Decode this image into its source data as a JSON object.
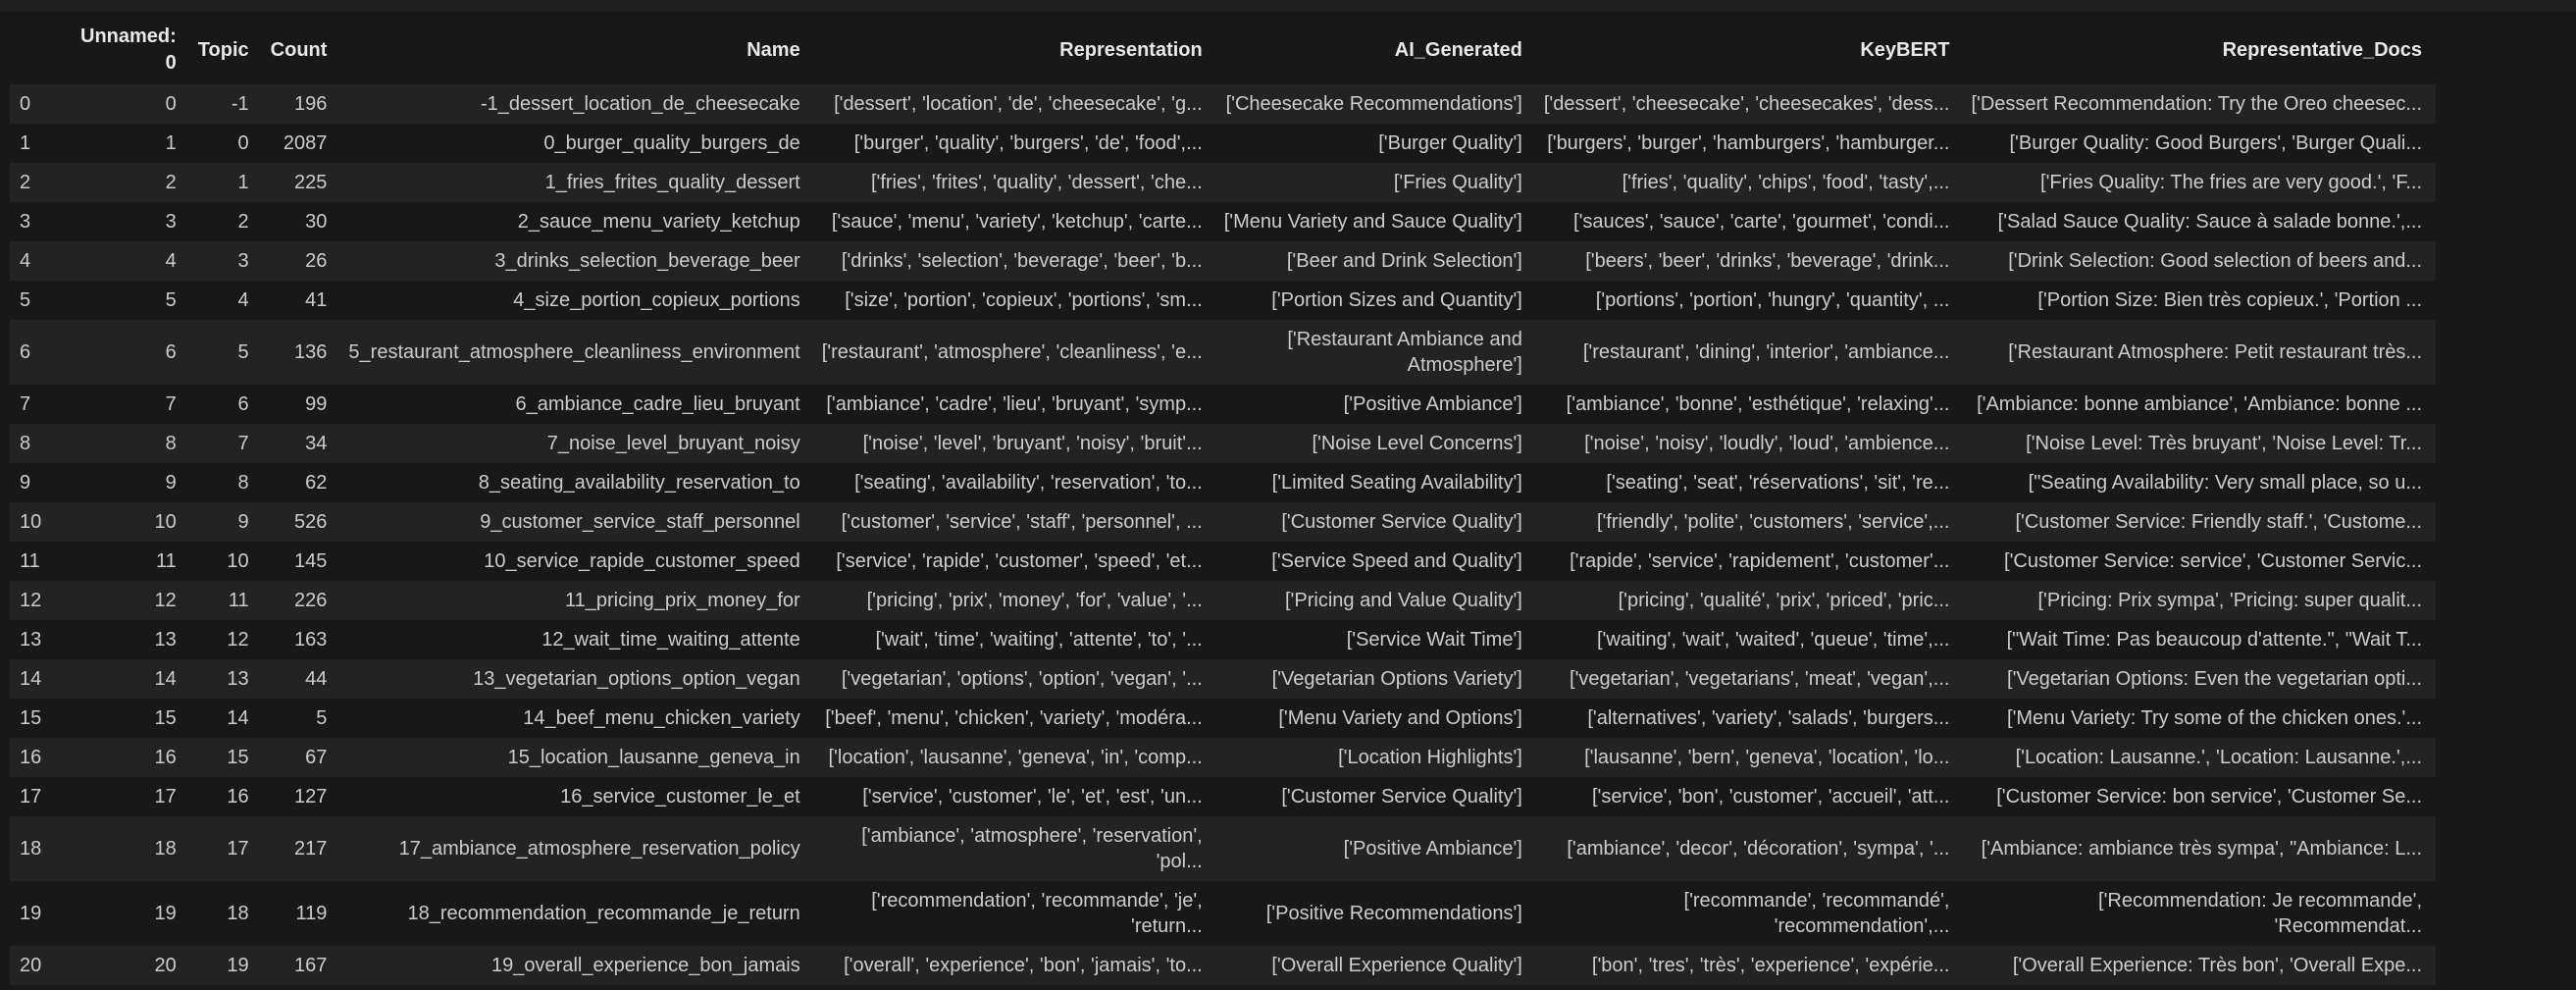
{
  "table": {
    "columns": [
      "",
      "Unnamed: 0",
      "Topic",
      "Count",
      "Name",
      "Representation",
      "AI_Generated",
      "KeyBERT",
      "Representative_Docs"
    ],
    "rows": [
      [
        "0",
        "0",
        "-1",
        "196",
        "-1_dessert_location_de_cheesecake",
        "['dessert', 'location', 'de', 'cheesecake', 'g...",
        "['Cheesecake Recommendations']",
        "['dessert', 'cheesecake', 'cheesecakes', 'dess...",
        "['Dessert Recommendation: Try the Oreo cheesec..."
      ],
      [
        "1",
        "1",
        "0",
        "2087",
        "0_burger_quality_burgers_de",
        "['burger', 'quality', 'burgers', 'de', 'food',...",
        "['Burger Quality']",
        "['burgers', 'burger', 'hamburgers', 'hamburger...",
        "['Burger Quality: Good Burgers', 'Burger Quali..."
      ],
      [
        "2",
        "2",
        "1",
        "225",
        "1_fries_frites_quality_dessert",
        "['fries', 'frites', 'quality', 'dessert', 'che...",
        "['Fries Quality']",
        "['fries', 'quality', 'chips', 'food', 'tasty',...",
        "['Fries Quality: The fries are very good.', 'F..."
      ],
      [
        "3",
        "3",
        "2",
        "30",
        "2_sauce_menu_variety_ketchup",
        "['sauce', 'menu', 'variety', 'ketchup', 'carte...",
        "['Menu Variety and Sauce Quality']",
        "['sauces', 'sauce', 'carte', 'gourmet', 'condi...",
        "['Salad Sauce Quality: Sauce à salade bonne.',..."
      ],
      [
        "4",
        "4",
        "3",
        "26",
        "3_drinks_selection_beverage_beer",
        "['drinks', 'selection', 'beverage', 'beer', 'b...",
        "['Beer and Drink Selection']",
        "['beers', 'beer', 'drinks', 'beverage', 'drink...",
        "['Drink Selection: Good selection of beers and..."
      ],
      [
        "5",
        "5",
        "4",
        "41",
        "4_size_portion_copieux_portions",
        "['size', 'portion', 'copieux', 'portions', 'sm...",
        "['Portion Sizes and Quantity']",
        "['portions', 'portion', 'hungry', 'quantity', ...",
        "['Portion Size: Bien très copieux.', 'Portion ..."
      ],
      [
        "6",
        "6",
        "5",
        "136",
        "5_restaurant_atmosphere_cleanliness_environment",
        "['restaurant', 'atmosphere', 'cleanliness', 'e...",
        "['Restaurant Ambiance and Atmosphere']",
        "['restaurant', 'dining', 'interior', 'ambiance...",
        "['Restaurant Atmosphere: Petit restaurant très..."
      ],
      [
        "7",
        "7",
        "6",
        "99",
        "6_ambiance_cadre_lieu_bruyant",
        "['ambiance', 'cadre', 'lieu', 'bruyant', 'symp...",
        "['Positive Ambiance']",
        "['ambiance', 'bonne', 'esthétique', 'relaxing'...",
        "['Ambiance: bonne ambiance', 'Ambiance: bonne ..."
      ],
      [
        "8",
        "8",
        "7",
        "34",
        "7_noise_level_bruyant_noisy",
        "['noise', 'level', 'bruyant', 'noisy', 'bruit'...",
        "['Noise Level Concerns']",
        "['noise', 'noisy', 'loudly', 'loud', 'ambience...",
        "['Noise Level: Très bruyant', 'Noise Level: Tr..."
      ],
      [
        "9",
        "9",
        "8",
        "62",
        "8_seating_availability_reservation_to",
        "['seating', 'availability', 'reservation', 'to...",
        "['Limited Seating Availability']",
        "['seating', 'seat', 'réservations', 'sit', 're...",
        "[\"Seating Availability: Very small place, so u..."
      ],
      [
        "10",
        "10",
        "9",
        "526",
        "9_customer_service_staff_personnel",
        "['customer', 'service', 'staff', 'personnel', ...",
        "['Customer Service Quality']",
        "['friendly', 'polite', 'customers', 'service',...",
        "['Customer Service: Friendly staff.', 'Custome..."
      ],
      [
        "11",
        "11",
        "10",
        "145",
        "10_service_rapide_customer_speed",
        "['service', 'rapide', 'customer', 'speed', 'et...",
        "['Service Speed and Quality']",
        "['rapide', 'service', 'rapidement', 'customer'...",
        "['Customer Service: service', 'Customer Servic..."
      ],
      [
        "12",
        "12",
        "11",
        "226",
        "11_pricing_prix_money_for",
        "['pricing', 'prix', 'money', 'for', 'value', '...",
        "['Pricing and Value Quality']",
        "['pricing', 'qualité', 'prix', 'priced', 'pric...",
        "['Pricing: Prix sympa', 'Pricing: super qualit..."
      ],
      [
        "13",
        "13",
        "12",
        "163",
        "12_wait_time_waiting_attente",
        "['wait', 'time', 'waiting', 'attente', 'to', '...",
        "['Service Wait Time']",
        "['waiting', 'wait', 'waited', 'queue', 'time',...",
        "[\"Wait Time: Pas beaucoup d'attente.\", \"Wait T..."
      ],
      [
        "14",
        "14",
        "13",
        "44",
        "13_vegetarian_options_option_vegan",
        "['vegetarian', 'options', 'option', 'vegan', '...",
        "['Vegetarian Options Variety']",
        "['vegetarian', 'vegetarians', 'meat', 'vegan',...",
        "['Vegetarian Options: Even the vegetarian opti..."
      ],
      [
        "15",
        "15",
        "14",
        "5",
        "14_beef_menu_chicken_variety",
        "['beef', 'menu', 'chicken', 'variety', 'modéra...",
        "['Menu Variety and Options']",
        "['alternatives', 'variety', 'salads', 'burgers...",
        "['Menu Variety: Try some of the chicken ones.'..."
      ],
      [
        "16",
        "16",
        "15",
        "67",
        "15_location_lausanne_geneva_in",
        "['location', 'lausanne', 'geneva', 'in', 'comp...",
        "['Location Highlights']",
        "['lausanne', 'bern', 'geneva', 'location', 'lo...",
        "['Location: Lausanne.', 'Location: Lausanne.',..."
      ],
      [
        "17",
        "17",
        "16",
        "127",
        "16_service_customer_le_et",
        "['service', 'customer', 'le', 'et', 'est', 'un...",
        "['Customer Service Quality']",
        "['service', 'bon', 'customer', 'accueil', 'att...",
        "['Customer Service: bon service', 'Customer Se..."
      ],
      [
        "18",
        "18",
        "17",
        "217",
        "17_ambiance_atmosphere_reservation_policy",
        "['ambiance', 'atmosphere', 'reservation', 'pol...",
        "['Positive Ambiance']",
        "['ambiance', 'decor', 'décoration', 'sympa', '...",
        "['Ambiance: ambiance très sympa', \"Ambiance: L..."
      ],
      [
        "19",
        "19",
        "18",
        "119",
        "18_recommendation_recommande_je_return",
        "['recommendation', 'recommande', 'je', 'return...",
        "['Positive Recommendations']",
        "['recommande', 'recommandé', 'recommendation',...",
        "['Recommendation: Je recommande', 'Recommendat..."
      ],
      [
        "20",
        "20",
        "19",
        "167",
        "19_overall_experience_bon_jamais",
        "['overall', 'experience', 'bon', 'jamais', 'to...",
        "['Overall Experience Quality']",
        "['bon', 'tres', 'très', 'experience', 'expérie...",
        "['Overall Experience: Très bon', 'Overall Expe..."
      ]
    ]
  }
}
